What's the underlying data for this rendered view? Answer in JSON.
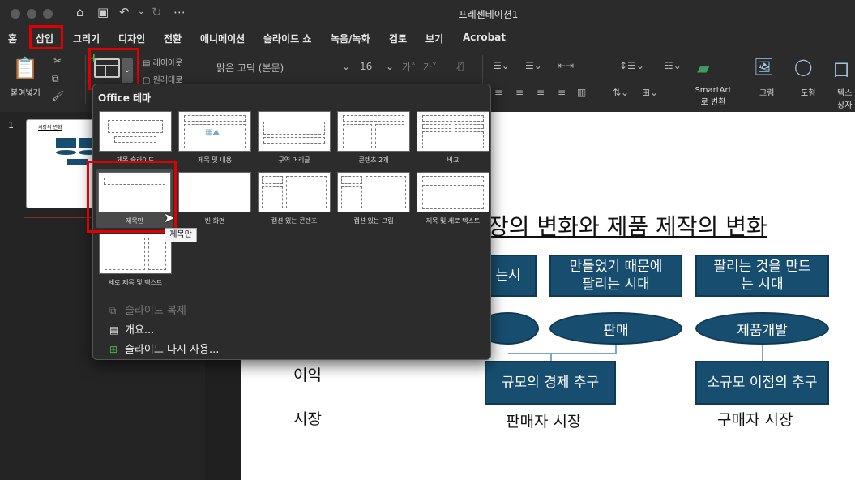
{
  "window": {
    "title": "프레젠테이션1"
  },
  "ribbon_tabs": [
    "홈",
    "삽입",
    "그리기",
    "디자인",
    "전환",
    "애니메이션",
    "슬라이드 쇼",
    "녹음/녹화",
    "검토",
    "보기",
    "Acrobat"
  ],
  "ribbon": {
    "paste_label": "붙여넣기",
    "layout_label": "레이아웃",
    "reset_label": "원래대로",
    "font_name": "맑은 고딕 (본문)",
    "font_size": "16",
    "smartart_label_1": "SmartArt",
    "smartart_label_2": "로 변환",
    "picture_label": "그림",
    "shapes_label": "도형",
    "textbox_label_1": "텍스",
    "textbox_label_2": "상자"
  },
  "thumbnails": {
    "slide_number": "1",
    "title": "시장의 변화"
  },
  "dropdown": {
    "header": "Office 테마",
    "layouts": [
      {
        "name": "제목 슬라이드"
      },
      {
        "name": "제목 및 내용"
      },
      {
        "name": "구역 머리글"
      },
      {
        "name": "콘텐츠 2개"
      },
      {
        "name": "비교"
      },
      {
        "name": "제목만"
      },
      {
        "name": "빈 화면"
      },
      {
        "name": "캡션 있는 콘텐츠"
      },
      {
        "name": "캡션 있는 그림"
      },
      {
        "name": "제목 및 세로 텍스트"
      },
      {
        "name": "세로 제목 및 텍스트"
      }
    ],
    "duplicate": "슬라이드 복제",
    "outline": "개요...",
    "reuse": "슬라이드 다시 사용..."
  },
  "tooltip": "제목만",
  "slide": {
    "title": "장의 변화와 제품 제작의 변화",
    "box1": "는시",
    "box2_l1": "만들었기 때문에",
    "box2_l2": "팔리는 시대",
    "box3_l1": "팔리는 것을 만드",
    "box3_l2": "는 시대",
    "ellipse2": "판매",
    "ellipse3": "제품개발",
    "box4": "규모의 경제 추구",
    "box5": "소규모 이점의 추구",
    "row_profit": "이익",
    "row_market": "시장",
    "seller": "판매자 시장",
    "buyer": "구매자 시장"
  },
  "colors": {
    "shape_fill": "#174e6f",
    "highlight": "#e00000"
  }
}
